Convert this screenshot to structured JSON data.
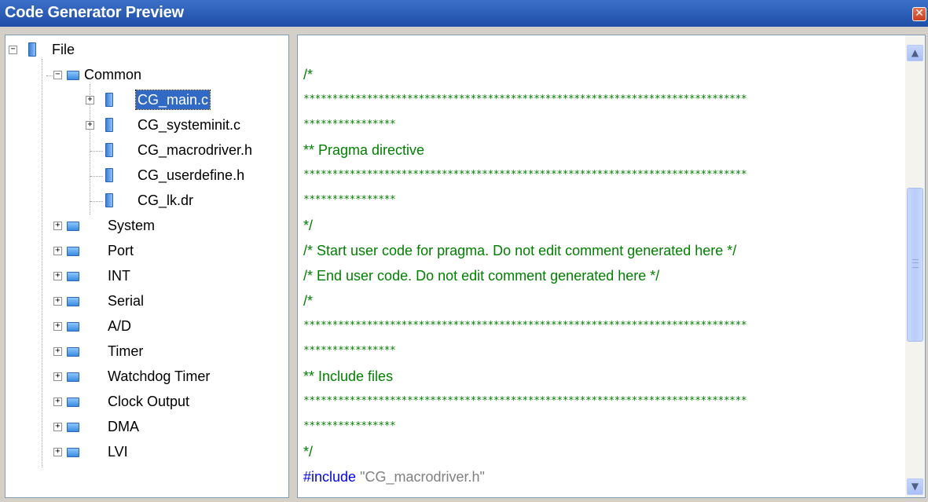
{
  "window": {
    "title": "Code Generator Preview"
  },
  "tree": {
    "root": "File",
    "common": "Common",
    "files": [
      "CG_main.c",
      "CG_systeminit.c",
      "CG_macrodriver.h",
      "CG_userdefine.h",
      "CG_lk.dr"
    ],
    "folders": [
      "System",
      "Port",
      "INT",
      "Serial",
      "A/D",
      "Timer",
      "Watchdog Timer",
      "Clock Output",
      "DMA",
      "LVI"
    ]
  },
  "code": {
    "lines": [
      "/*",
      "*****************************************************************************",
      "****************",
      "** Pragma directive",
      "*****************************************************************************",
      "****************",
      "*/",
      "/* Start user code for pragma. Do not edit comment generated here */",
      "/* End user code. Do not edit comment generated here */",
      "/*",
      "*****************************************************************************",
      "****************",
      "** Include files",
      "*****************************************************************************",
      "****************",
      "*/"
    ],
    "include_keyword": "#include",
    "include_target": "\"CG_macrodriver.h\""
  },
  "icons": {
    "close": "close-icon",
    "scroll_up": "scroll-up-icon",
    "scroll_down": "scroll-down-icon"
  },
  "colors": {
    "titlebar": "#2c5fb8",
    "selection": "#316ac5",
    "comment": "#008000",
    "keyword": "#0000ff"
  }
}
